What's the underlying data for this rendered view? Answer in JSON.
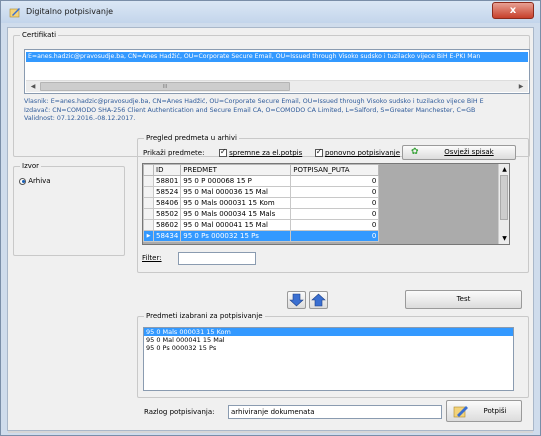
{
  "window": {
    "title": "Digitalno potpisivanje",
    "close_label": "x"
  },
  "certifikati": {
    "legend": "Certifikati",
    "selected_line": "E=anes.hadzic@pravosudje.ba, CN=Anes Hadžić, OU=Corporate Secure Email, OU=Issued through Visoko sudsko i tuzilacko vijece BiH E-PKI Man",
    "scroll_thumb": "III",
    "vlasnik": "Vlasnik: E=anes.hadzic@pravosudje.ba, CN=Anes Hadžić, OU=Corporate Secure Email, OU=Issued through Visoko sudsko i tuzilacko vijece BiH E",
    "izdavac": "Izdavač: CN=COMODO SHA-256 Client Authentication and Secure Email CA, O=COMODO CA Limited, L=Salford, S=Greater Manchester, C=GB",
    "validnost": "Validnost: 07.12.2016.-08.12.2017."
  },
  "izvor": {
    "legend": "Izvor",
    "option": "Arhiva"
  },
  "pregled": {
    "legend": "Pregled predmeta u arhivi",
    "prikazi_label": "Prikaži predmete:",
    "check_spremne": "spremne za el.potpis",
    "check_ponovno": "ponovno potpisivanje",
    "refresh_label": "Osvježi spisak",
    "columns": [
      "ID",
      "PREDMET",
      "POTPISAN_PUTA"
    ],
    "rows": [
      {
        "id": "58801",
        "predmet": "95 0 P 000068 15 P",
        "puta": "0"
      },
      {
        "id": "58524",
        "predmet": "95 0 Mal 000036 15 Mal",
        "puta": "0"
      },
      {
        "id": "58406",
        "predmet": "95 0 Mals 000031 15 Kom",
        "puta": "0"
      },
      {
        "id": "58502",
        "predmet": "95 0 Mals 000034 15 Mals",
        "puta": "0"
      },
      {
        "id": "58602",
        "predmet": "95 0 Mal 000041 15 Mal",
        "puta": "0"
      },
      {
        "id": "58434",
        "predmet": "95 0 Ps 000032 15 Ps",
        "puta": "0"
      }
    ],
    "filter_label": "Filter:",
    "filter_value": ""
  },
  "test_label": "Test",
  "izabrani": {
    "legend": "Predmeti izabrani za potpisivanje",
    "items": [
      "95 0 Mals 000031 15 Kom",
      "95 0 Mal 000041 15 Mal",
      "95 0 Ps 000032 15 Ps"
    ]
  },
  "razlog": {
    "label": "Razlog potpisivanja:",
    "value": "arhiviranje dokumenata"
  },
  "potpisi_label": "Potpiši",
  "colors": {
    "selection": "#3399ff",
    "link_text": "#2f5b9a",
    "arrow_blue": "#3a6fd1"
  }
}
